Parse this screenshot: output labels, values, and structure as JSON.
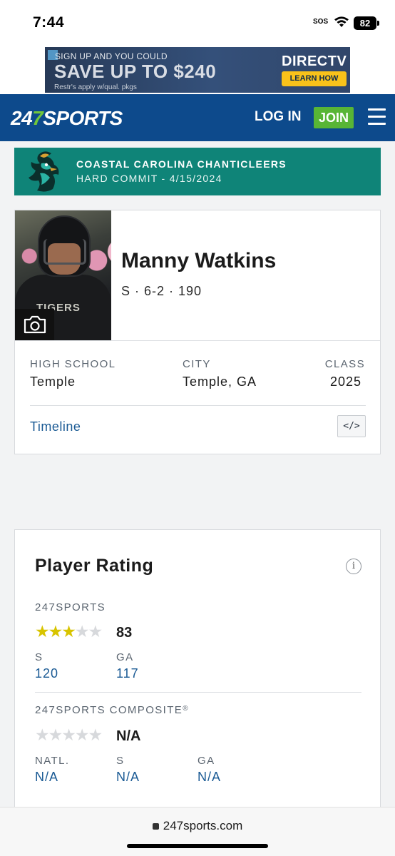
{
  "status_bar": {
    "time": "7:44",
    "sos": "SOS",
    "battery": "82"
  },
  "ad": {
    "line1": "SIGN UP AND YOU COULD",
    "headline": "SAVE UP TO $240",
    "fine_print": "Restr's apply w/qual. pkgs",
    "brand": "DIRECTV",
    "cta": "LEARN HOW"
  },
  "header": {
    "logo_pre": "24",
    "logo_seven": "7",
    "logo_post": "SPORTS",
    "login": "LOG IN",
    "join": "JOIN",
    "colors": {
      "bar": "#0d4a8c",
      "join": "#58b535"
    }
  },
  "commit": {
    "team": "COASTAL CAROLINA CHANTICLEERS",
    "status": "HARD COMMIT - 4/15/2024",
    "color": "#0f8478"
  },
  "player": {
    "name": "Manny Watkins",
    "meta": "S · 6-2 · 190",
    "jersey_text": "TIGERS",
    "high_school_label": "HIGH SCHOOL",
    "high_school": "Temple",
    "city_label": "CITY",
    "city": "Temple, GA",
    "class_label": "CLASS",
    "class": "2025",
    "timeline": "Timeline",
    "embed": "</>"
  },
  "rating": {
    "title": "Player Rating",
    "info": "i",
    "s247": {
      "label": "247SPORTS",
      "stars_filled": 3,
      "stars_total": 5,
      "score": "83",
      "ranks": [
        {
          "label": "S",
          "value": "120"
        },
        {
          "label": "GA",
          "value": "117"
        }
      ]
    },
    "composite": {
      "label": "247SPORTS COMPOSITE",
      "mark": "®",
      "stars_filled": 0,
      "stars_total": 5,
      "score": "N/A",
      "ranks": [
        {
          "label": "NATL.",
          "value": "N/A"
        },
        {
          "label": "S",
          "value": "N/A"
        },
        {
          "label": "GA",
          "value": "N/A"
        }
      ]
    },
    "colors": {
      "star_on": "#d8c400",
      "star_off": "#d7d9dc",
      "link": "#1a5a94"
    }
  },
  "browser": {
    "url": "247sports.com"
  }
}
